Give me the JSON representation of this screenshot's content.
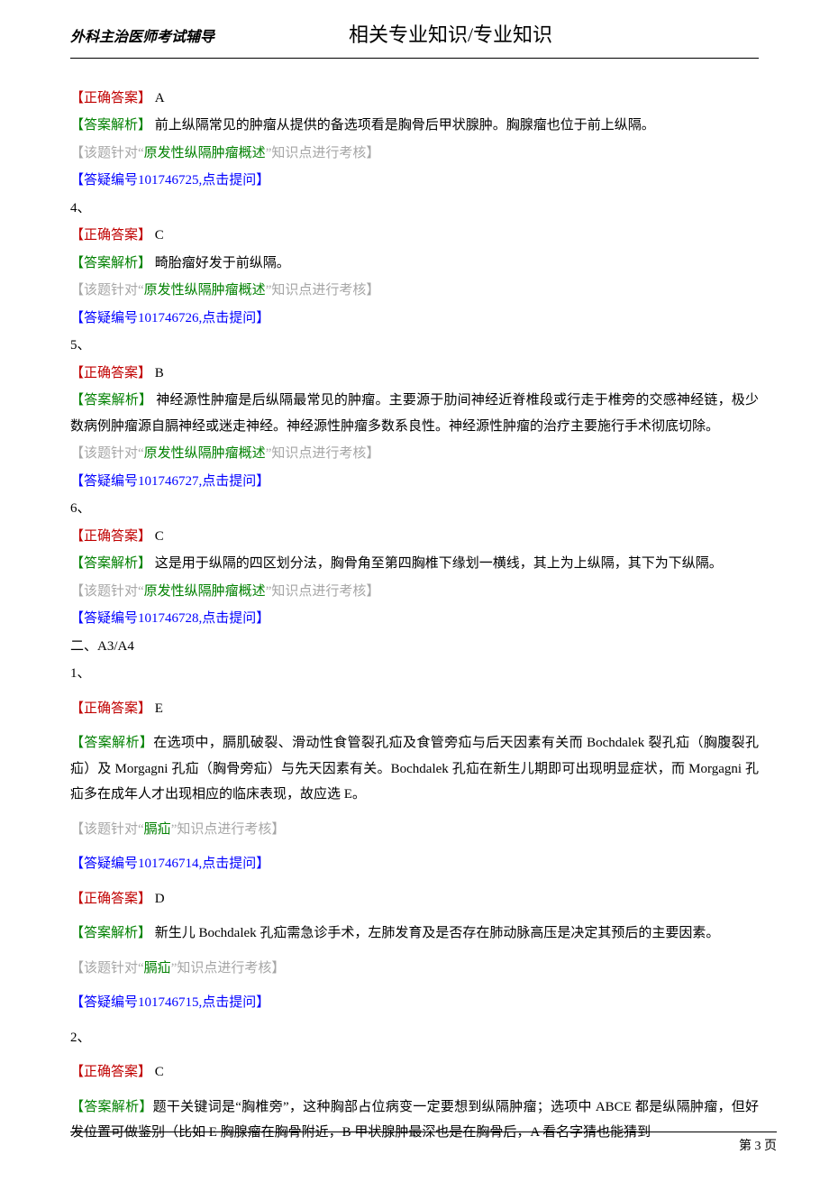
{
  "header": {
    "left": "外科主治医师考试辅导",
    "title": "相关专业知识/专业知识"
  },
  "blocks": [
    {
      "type": "answer",
      "label": "【正确答案】",
      "value": " A"
    },
    {
      "type": "analysis",
      "label": "【答案解析】",
      "text": " 前上纵隔常见的肿瘤从提供的备选项看是胸骨后甲状腺肿。胸腺瘤也位于前上纵隔。"
    },
    {
      "type": "topic",
      "prefix": "【该题针对“",
      "topic": "原发性纵隔肿瘤概述",
      "suffix": "”知识点进行考核】"
    },
    {
      "type": "qid",
      "text": "【答疑编号101746725,点击提问】"
    },
    {
      "type": "num",
      "text": "4、"
    },
    {
      "type": "answer",
      "label": "【正确答案】",
      "value": " C"
    },
    {
      "type": "analysis",
      "label": "【答案解析】",
      "text": " 畸胎瘤好发于前纵隔。"
    },
    {
      "type": "topic",
      "prefix": "【该题针对“",
      "topic": "原发性纵隔肿瘤概述",
      "suffix": "”知识点进行考核】"
    },
    {
      "type": "qid",
      "text": "【答疑编号101746726,点击提问】"
    },
    {
      "type": "num",
      "text": "5、"
    },
    {
      "type": "answer",
      "label": "【正确答案】",
      "value": " B"
    },
    {
      "type": "analysis",
      "label": "【答案解析】",
      "text": " 神经源性肿瘤是后纵隔最常见的肿瘤。主要源于肋间神经近脊椎段或行走于椎旁的交感神经链，极少数病例肿瘤源自膈神经或迷走神经。神经源性肿瘤多数系良性。神经源性肿瘤的治疗主要施行手术彻底切除。"
    },
    {
      "type": "topic",
      "prefix": "【该题针对“",
      "topic": "原发性纵隔肿瘤概述",
      "suffix": "”知识点进行考核】"
    },
    {
      "type": "qid",
      "text": "【答疑编号101746727,点击提问】"
    },
    {
      "type": "num",
      "text": "6、"
    },
    {
      "type": "answer",
      "label": "【正确答案】",
      "value": " C"
    },
    {
      "type": "analysis",
      "label": "【答案解析】",
      "text": " 这是用于纵隔的四区划分法，胸骨角至第四胸椎下缘划一横线，其上为上纵隔，其下为下纵隔。"
    },
    {
      "type": "topic",
      "prefix": "【该题针对“",
      "topic": "原发性纵隔肿瘤概述",
      "suffix": "”知识点进行考核】"
    },
    {
      "type": "qid",
      "text": "【答疑编号101746728,点击提问】"
    },
    {
      "type": "section",
      "text": "二、A3/A4"
    },
    {
      "type": "num",
      "text": "1、"
    },
    {
      "type": "answer",
      "label": "【正确答案】",
      "value": " E",
      "spaced": true
    },
    {
      "type": "analysis",
      "label": "【答案解析】",
      "text": "在选项中，膈肌破裂、滑动性食管裂孔疝及食管旁疝与后天因素有关而 Bochdalek 裂孔疝（胸腹裂孔疝）及 Morgagni 孔疝（胸骨旁疝）与先天因素有关。Bochdalek 孔疝在新生儿期即可出现明显症状，而 Morgagni 孔疝多在成年人才出现相应的临床表现，故应选 E。",
      "spaced": true
    },
    {
      "type": "topic",
      "prefix": "【该题针对“",
      "topic": "膈疝",
      "suffix": "”知识点进行考核】",
      "spaced": true
    },
    {
      "type": "qid",
      "text": "【答疑编号101746714,点击提问】",
      "spaced": true
    },
    {
      "type": "answer",
      "label": "【正确答案】",
      "value": " D",
      "spaced": true
    },
    {
      "type": "analysis",
      "label": "【答案解析】",
      "text": " 新生儿 Bochdalek 孔疝需急诊手术，左肺发育及是否存在肺动脉高压是决定其预后的主要因素。",
      "spaced": true
    },
    {
      "type": "topic",
      "prefix": "【该题针对“",
      "topic": "膈疝",
      "suffix": "”知识点进行考核】",
      "spaced": true
    },
    {
      "type": "qid",
      "text": "【答疑编号101746715,点击提问】",
      "spaced": true
    },
    {
      "type": "num",
      "text": "2、"
    },
    {
      "type": "answer",
      "label": "【正确答案】",
      "value": " C",
      "spaced": true
    },
    {
      "type": "analysis",
      "label": "【答案解析】",
      "text": "题干关键词是“胸椎旁”，这种胸部占位病变一定要想到纵隔肿瘤；选项中 ABCE 都是纵隔肿瘤，但好发位置可做鉴别（比如 E 胸腺瘤在胸骨附近，B 甲状腺肿最深也是在胸骨后，A 看名字猜也能猜到",
      "spaced": true
    }
  ],
  "footer": {
    "page": "第 3 页"
  }
}
